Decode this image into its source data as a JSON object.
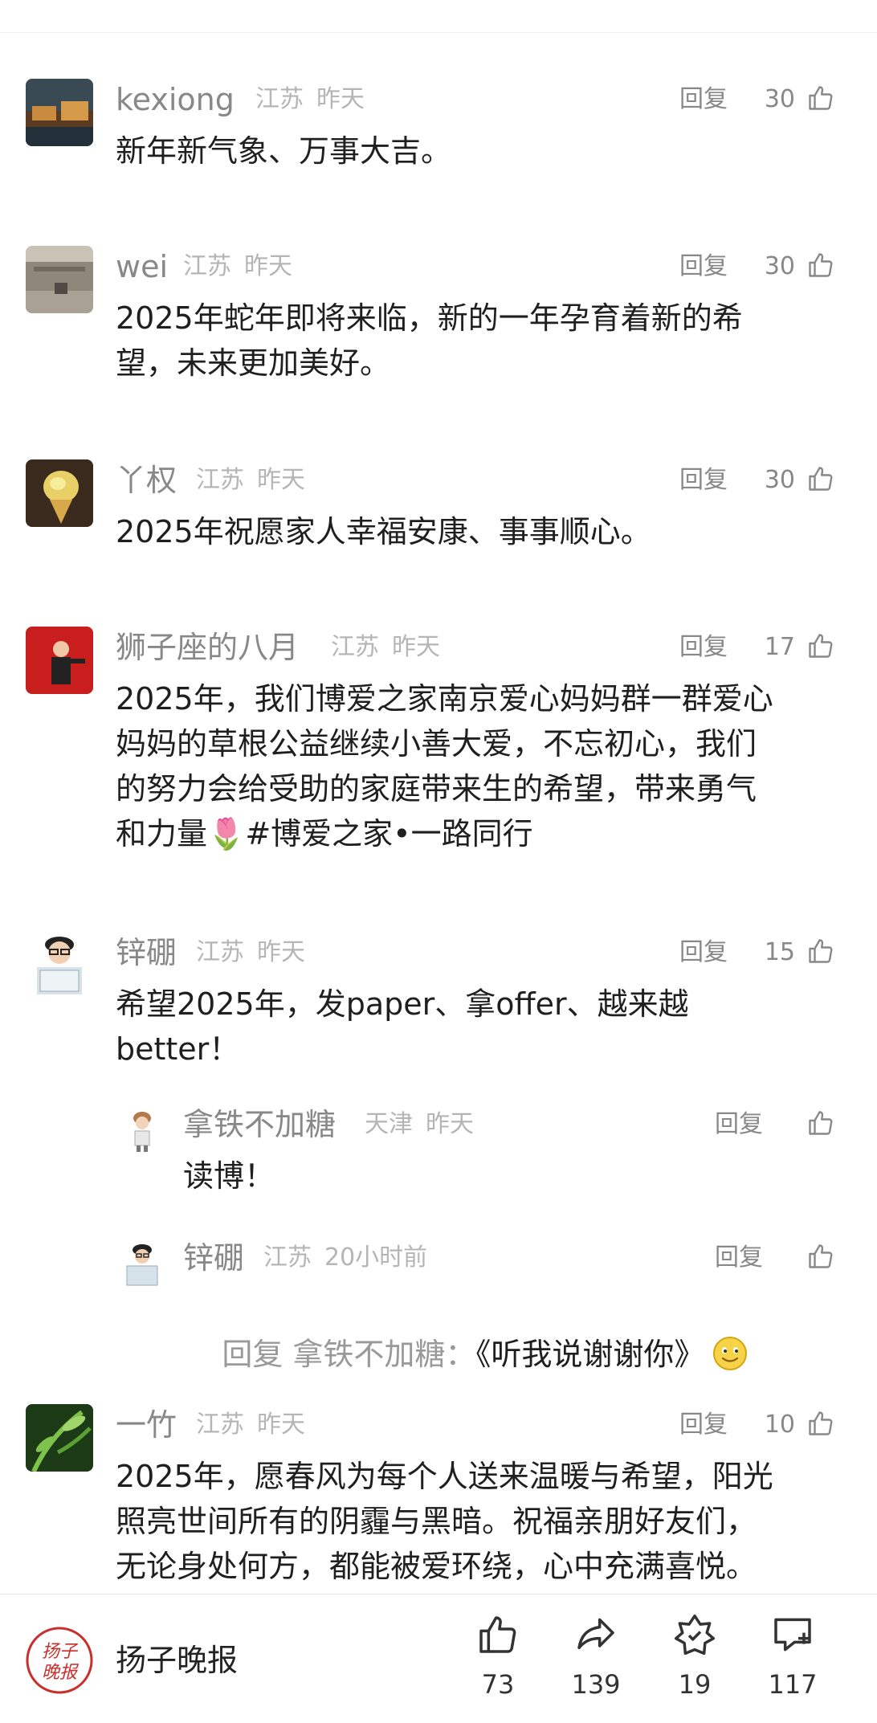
{
  "comments": [
    {
      "user": "kexiong",
      "location": "江苏",
      "time": "昨天",
      "reply": "回复",
      "likes": "30",
      "text": "新年新气象、万事大吉。"
    },
    {
      "user": "wei",
      "location": "江苏",
      "time": "昨天",
      "reply": "回复",
      "likes": "30",
      "text": "2025年蛇年即将来临，新的一年孕育着新的希\n望，未来更加美好。"
    },
    {
      "user": "丫权",
      "location": "江苏",
      "time": "昨天",
      "reply": "回复",
      "likes": "30",
      "text": "2025年祝愿家人幸福安康、事事顺心。"
    },
    {
      "user": "狮子座的八月",
      "location": "江苏",
      "time": "昨天",
      "reply": "回复",
      "likes": "17",
      "text_before_emoji": "2025年，我们博爱之家南京爱心妈妈群一群爱心\n妈妈的草根公益继续小善大爱，不忘初心，我们\n的努力会给受助的家庭带来生的希望，带来勇气\n和力量",
      "emoji": "🌷",
      "text_after_emoji": "#博爱之家•一路同行"
    },
    {
      "user": "锌硼",
      "location": "江苏",
      "time": "昨天",
      "reply": "回复",
      "likes": "15",
      "text": "希望2025年，发paper、拿offer、越来越\nbetter！"
    },
    {
      "user": "一竹",
      "location": "江苏",
      "time": "昨天",
      "reply": "回复",
      "likes": "10",
      "text": "2025年，愿春风为每个人送来温暖与希望，阳光\n照亮世间所有的阴霾与黑暗。祝福亲朋好友们，\n无论身处何方，都能被爱环绕，心中充满喜悦。"
    }
  ],
  "replies": [
    {
      "user": "拿铁不加糖",
      "location": "天津",
      "time": "昨天",
      "reply": "回复",
      "text": "读博！"
    },
    {
      "user": "锌硼",
      "location": "江苏",
      "time": "20小时前",
      "reply": "回复",
      "prefix": "回复 拿铁不加糖：",
      "text": "《听我说谢谢你》"
    }
  ],
  "bottom_bar": {
    "brand": "扬子晚报",
    "logo_text": "扬子晚报",
    "like_count": "73",
    "share_count": "139",
    "collect_count": "19",
    "comment_count": "117"
  },
  "icons": {
    "like": "thumbs-up-icon",
    "share": "share-arrow-icon",
    "collect": "star-badge-icon",
    "comment": "comment-add-icon"
  },
  "colors": {
    "meta": "#b5b5b5",
    "username": "#888888",
    "logo_red": "#c9302c"
  }
}
